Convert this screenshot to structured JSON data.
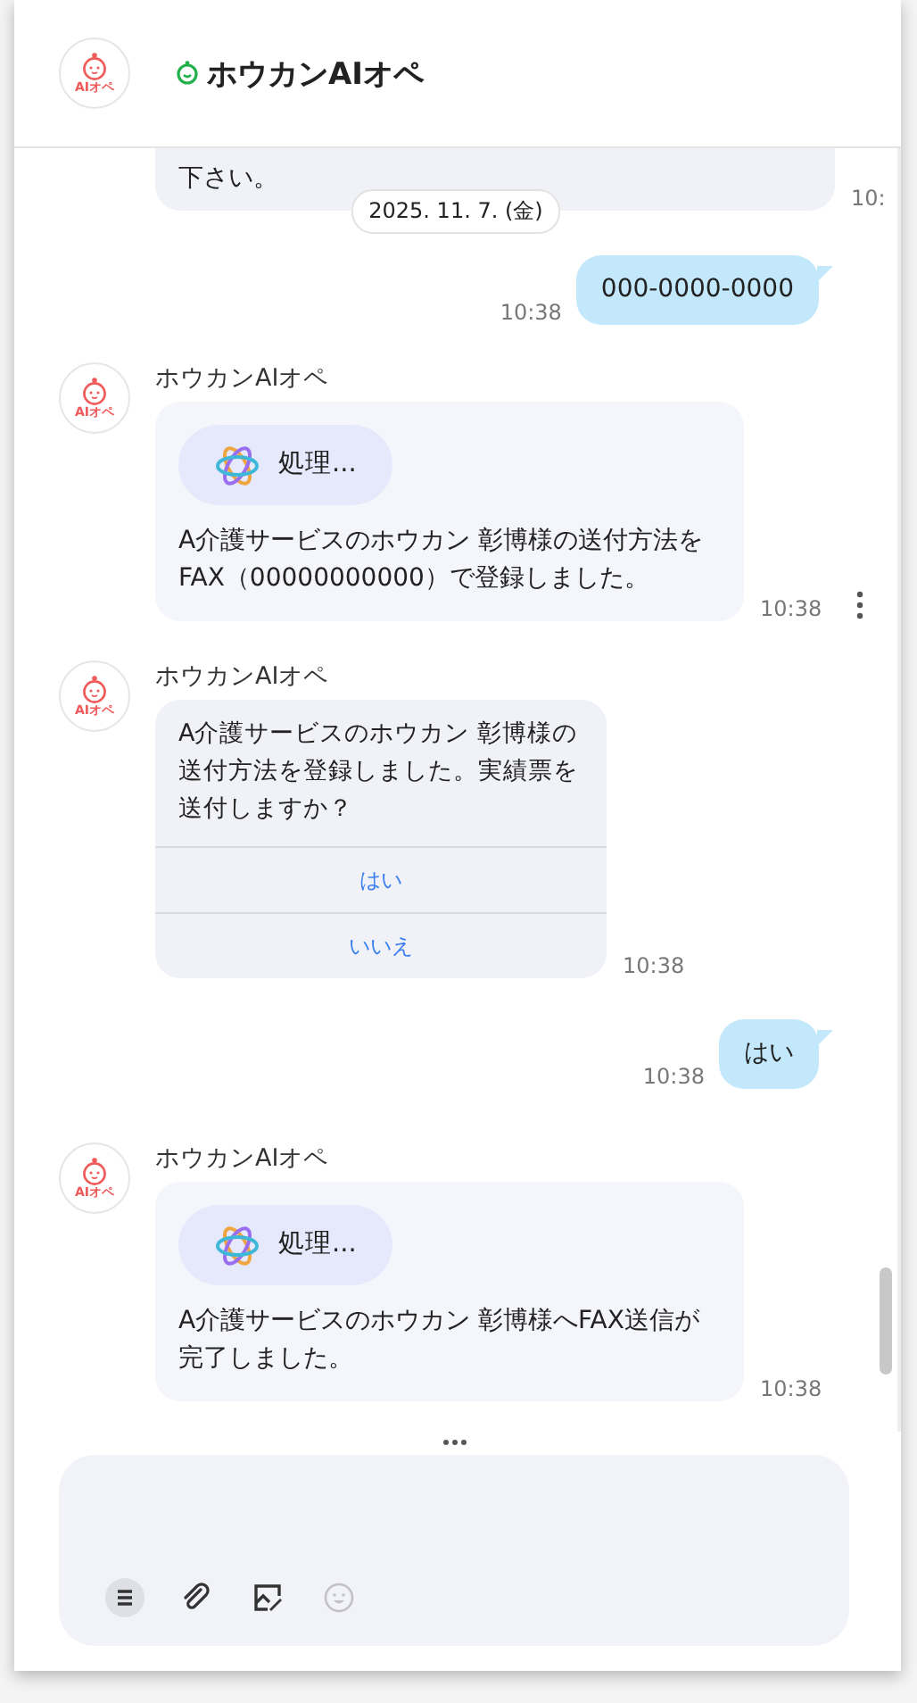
{
  "header": {
    "avatar_label": "AIオペ",
    "title": "ホウカンAIオペ",
    "online": true
  },
  "messages": [
    {
      "kind": "bot_partial",
      "text": "下さい。",
      "time": "10:"
    },
    {
      "kind": "date",
      "text": "2025. 11. 7. (金)"
    },
    {
      "kind": "user",
      "text": "000-0000-0000",
      "time": "10:38"
    },
    {
      "kind": "bot_processing",
      "avatar_label": "AIオペ",
      "sender": "ホウカンAIオペ",
      "status": "処理...",
      "text": "A介護サービスのホウカン 彰博様の送付方法をFAX（00000000000）で登録しました。",
      "time": "10:38",
      "show_menu": true
    },
    {
      "kind": "bot_question",
      "avatar_label": "AIオペ",
      "sender": "ホウカンAIオペ",
      "text": "A介護サービスのホウカン 彰博様の送付方法を登録しました。実績票を送付しますか？",
      "options": [
        "はい",
        "いいえ"
      ],
      "time": "10:38"
    },
    {
      "kind": "user",
      "text": "はい",
      "time": "10:38"
    },
    {
      "kind": "bot_processing",
      "avatar_label": "AIオペ",
      "sender": "ホウカンAIオペ",
      "status": "処理...",
      "text": "A介護サービスのホウカン 彰博様へFAX送信が完了しました。",
      "time": "10:38",
      "show_menu": false
    }
  ],
  "composer": {
    "tools": [
      {
        "kind": "menu",
        "selected": true,
        "disabled": false
      },
      {
        "kind": "attach",
        "selected": false,
        "disabled": false
      },
      {
        "kind": "image",
        "selected": false,
        "disabled": false
      },
      {
        "kind": "emoji",
        "selected": false,
        "disabled": true
      }
    ]
  }
}
